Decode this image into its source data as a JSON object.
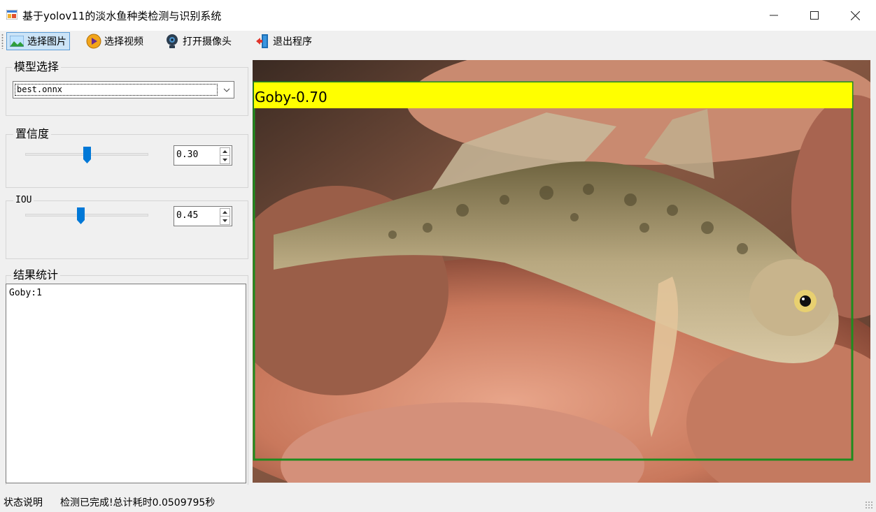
{
  "window": {
    "title": "基于yolov11的淡水鱼种类检测与识别系统",
    "minimize_icon": "minimize-icon",
    "maximize_icon": "maximize-icon",
    "close_icon": "close-icon"
  },
  "toolbar": {
    "items": [
      {
        "label": "选择图片",
        "icon": "picture-icon",
        "active": true
      },
      {
        "label": "选择视频",
        "icon": "play-video-icon",
        "active": false
      },
      {
        "label": "打开摄像头",
        "icon": "webcam-icon",
        "active": false
      },
      {
        "label": "退出程序",
        "icon": "exit-door-icon",
        "active": false
      }
    ]
  },
  "model": {
    "group_title": "模型选择",
    "selected": "best.onnx"
  },
  "confidence": {
    "group_title": "置信度",
    "value": "0.30",
    "slider_fraction": 0.5
  },
  "iou": {
    "group_title": "IOU",
    "value": "0.45",
    "slider_fraction": 0.45
  },
  "results": {
    "group_title": "结果统计",
    "lines": [
      "Goby:1"
    ]
  },
  "detection": {
    "label": "Goby-0.70",
    "box_color": "#1e8c1e",
    "label_bg": "#ffff00"
  },
  "status": {
    "label": "状态说明",
    "text": "检测已完成!总计耗时0.0509795秒"
  },
  "colors": {
    "accent": "#0078d7",
    "toolbar_active": "#cce4f7"
  }
}
